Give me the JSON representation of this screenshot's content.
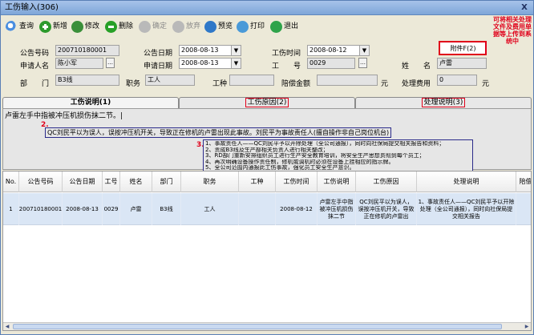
{
  "window": {
    "title": "工伤输入(306)",
    "close_label": "X"
  },
  "toolbar": [
    {
      "key": "search",
      "label": "查询",
      "icon": "search-icon",
      "enabled": true
    },
    {
      "key": "add",
      "label": "新增",
      "icon": "add-icon",
      "enabled": true
    },
    {
      "key": "edit",
      "label": "修改",
      "icon": "edit-icon",
      "enabled": true
    },
    {
      "key": "delete",
      "label": "删除",
      "icon": "delete-icon",
      "enabled": true
    },
    {
      "key": "confirm",
      "label": "确定",
      "icon": "confirm-icon",
      "enabled": false
    },
    {
      "key": "cancel",
      "label": "放弃",
      "icon": "cancel-icon",
      "enabled": false
    },
    {
      "key": "preview",
      "label": "预览",
      "icon": "preview-icon",
      "enabled": true
    },
    {
      "key": "print",
      "label": "打印",
      "icon": "print-icon",
      "enabled": true
    },
    {
      "key": "exit",
      "label": "退出",
      "icon": "exit-icon",
      "enabled": true
    }
  ],
  "hint": "可将相关处理文件及费用单据等上传到系统中",
  "form": {
    "doc_no_label": "公告号码",
    "doc_no": "200710180001",
    "doc_date_label": "公告日期",
    "doc_date": "2008-08-13",
    "injury_time_label": "工伤时间",
    "injury_time": "2008-08-12",
    "attach_label": "附件F(2)",
    "applicant_label": "申请人名",
    "applicant": "陈小军",
    "apply_date_label": "申请日期",
    "apply_date": "2008-08-13",
    "emp_no_label": "工　　号",
    "emp_no": "0029",
    "name_label": "姓　　名",
    "name": "卢雷",
    "dept_label": "部　　门",
    "dept": "B3线",
    "position_label": "职务",
    "position": "工人",
    "injury_type_label": "工种",
    "injury_type": "",
    "compensation_label": "陪偿金额",
    "compensation": "",
    "currency_unit_1": "元",
    "handling_fee_label": "处理费用",
    "handling_fee": "0",
    "currency_unit_2": "元"
  },
  "tabs": [
    {
      "label": "工伤说明(1)",
      "active": true
    },
    {
      "label": "工伤原因(2)",
      "active": false
    },
    {
      "label": "处理说明(3)",
      "active": false
    }
  ],
  "description": {
    "text": "卢雷左手中指被冲压机损伤抹二节。|",
    "marker2": "2.",
    "cause": "QC刘民平以为误人，误按冲压机开关，导致正在修机的卢雷出现此事故。刘民平为事故责任人(擅自操作非自己岗位机台)",
    "marker3": "3.",
    "handling": [
      "1、事故责任人——QC刘民平予以开除处理（全公司通报），同时向社保局提交相关报告和资料；",
      "2、责成B3线及生产部相关负责人进行相关整改；",
      "3、RD部门重新安排组织员工进行生产安全教育培训，将安全生产思想贯彻到每个员工；",
      "4、再次明确设备操作责任制，修机或调机时必须在设备上挂相应的指示牌。",
      "5、全公司范围内通报此工伤事故，强化员工安全生产意识。"
    ]
  },
  "grid": {
    "columns": [
      "No.",
      "公告号码",
      "公告日期",
      "工号",
      "姓名",
      "部门",
      "职务",
      "工种",
      "工伤时间",
      "工伤说明",
      "工伤原因",
      "处理说明",
      "陪偿"
    ],
    "rows": [
      {
        "no": "1",
        "doc_no": "200710180001",
        "doc_date": "2008-08-13",
        "emp_no": "0029",
        "name": "卢雷",
        "dept": "B3线",
        "position": "工人",
        "type": "",
        "injury_time": "2008-08-12",
        "desc": "卢雷左手中指被冲压机损伤抹二节",
        "cause": "QC刘民平以为误人，误按冲压机开关，导致正在修机的卢雷出",
        "handling": "1、事故责任人——QC刘民平予以开除处理（全公司通报），同时向社保局提交相关报告"
      }
    ]
  }
}
